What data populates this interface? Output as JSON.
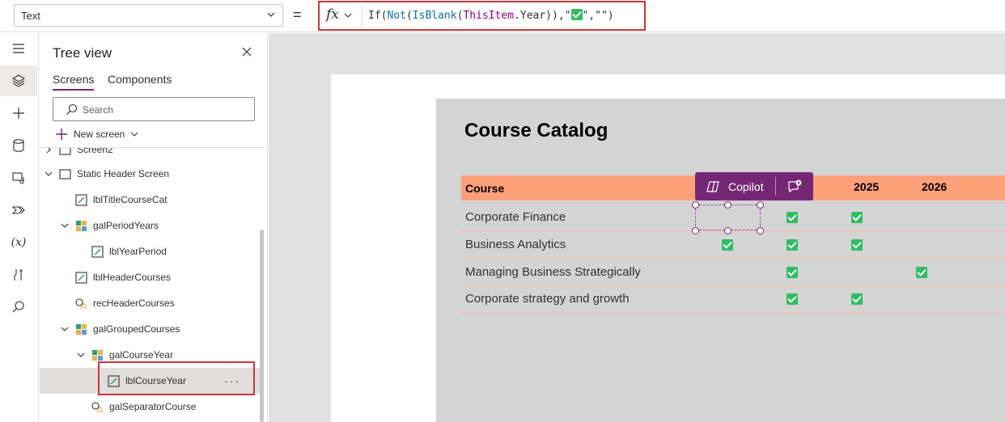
{
  "formula_bar": {
    "property": "Text",
    "equals": "=",
    "fx_label": "fx",
    "formula": {
      "p1": "If(",
      "p2": "Not",
      "p3": "(",
      "p4": "IsBlank",
      "p5": "(",
      "p6": "ThisItem",
      "p7": ".Year)),\"",
      "p8": "\",\"\")"
    }
  },
  "rail": {
    "items": [
      "menu-icon",
      "layers-icon",
      "plus-icon",
      "database-icon",
      "media-icon",
      "power-automate-icon",
      "variables-icon",
      "tools-icon",
      "search-icon"
    ],
    "variables_label": "(x)"
  },
  "tree_view": {
    "title": "Tree view",
    "tabs": [
      "Screens",
      "Components"
    ],
    "search_placeholder": "Search",
    "new_screen_label": "New screen",
    "items": [
      {
        "label": "Screen2",
        "icon": "screen-icon",
        "level": 0
      },
      {
        "label": "Static Header Screen",
        "icon": "screen-icon",
        "level": 0
      },
      {
        "label": "lblTitleCourseCat",
        "icon": "label-icon",
        "level": 1
      },
      {
        "label": "galPeriodYears",
        "icon": "gallery-icon",
        "level": 1
      },
      {
        "label": "lblYearPeriod",
        "icon": "label-icon",
        "level": 2
      },
      {
        "label": "lblHeaderCourses",
        "icon": "label-icon",
        "level": 1
      },
      {
        "label": "recHeaderCourses",
        "icon": "shape-icon",
        "level": 1
      },
      {
        "label": "galGroupedCourses",
        "icon": "gallery-icon",
        "level": 1
      },
      {
        "label": "galCourseYear",
        "icon": "gallery-icon",
        "level": 2
      },
      {
        "label": "lblCourseYear",
        "icon": "label-icon",
        "level": 3
      },
      {
        "label": "galSeparatorCourse",
        "icon": "shape-icon",
        "level": 2
      }
    ],
    "more_label": "···"
  },
  "canvas": {
    "title": "Course Catalog",
    "header_course": "Course",
    "years": [
      "2025",
      "2026"
    ],
    "courses": [
      {
        "name": "Corporate Finance"
      },
      {
        "name": "Business Analytics"
      },
      {
        "name": "Managing Business Strategically"
      },
      {
        "name": "Corporate strategy and growth"
      }
    ],
    "copilot_label": "Copilot"
  },
  "colors": {
    "accent": "#742774",
    "header": "#ffa07a",
    "check": "#2dbe60",
    "highlight": "#d13438"
  }
}
